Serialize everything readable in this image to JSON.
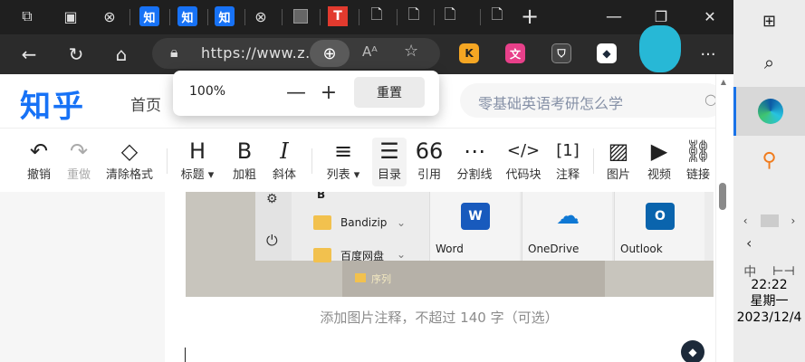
{
  "browser": {
    "tabs": [
      {
        "icon": "collections-icon"
      },
      {
        "icon": "tab-actions-icon"
      },
      {
        "icon": "blocked-page-icon"
      },
      {
        "icon": "zhihu-icon",
        "text": "知"
      },
      {
        "icon": "zhihu-icon",
        "text": "知"
      },
      {
        "icon": "zhihu-icon",
        "text": "知"
      },
      {
        "icon": "blocked-page-icon"
      },
      {
        "icon": "image-thumbnail-icon"
      },
      {
        "icon": "toutiao-icon",
        "text": "T"
      },
      {
        "icon": "page-icon"
      },
      {
        "icon": "page-icon"
      },
      {
        "icon": "page-icon"
      }
    ],
    "url": "https://www.z...",
    "window_controls": {
      "minimize": "—",
      "restore": "❐",
      "close": "✕"
    }
  },
  "zoom_popup": {
    "value": "100%",
    "minus": "—",
    "plus": "+",
    "reset_label": "重置"
  },
  "zhihu": {
    "logo": "知乎",
    "home": "首页",
    "search_placeholder": "零基础英语考研怎么学"
  },
  "toolbar": {
    "undo": "撤销",
    "redo": "重做",
    "clear_format": "清除格式",
    "heading": "标题",
    "bold": "加粗",
    "italic": "斜体",
    "list": "列表",
    "toc": "目录",
    "quote": "引用",
    "divider": "分割线",
    "code": "代码块",
    "footnote": "注释",
    "image": "图片",
    "video": "视频",
    "link": "链接",
    "icons": {
      "heading": "H",
      "bold": "B",
      "italic": "I",
      "quote": "66",
      "code": "</>",
      "footnote": "[1]"
    }
  },
  "embedded_screenshot": {
    "top_letter": "B",
    "folder1": "Bandizip",
    "folder2": "百度网盘",
    "folder3": "序列",
    "apps": [
      {
        "name": "Word",
        "letter": "W",
        "color": "#185abd"
      },
      {
        "name": "OneDrive",
        "letter": "☁",
        "color": "#0f78d4"
      },
      {
        "name": "Outlook",
        "letter": "O",
        "color": "#0a64ad"
      }
    ]
  },
  "caption_placeholder": "添加图片注释，不超过 140 字（可选）",
  "taskbar": {
    "time": "22:22",
    "weekday": "星期一",
    "date": "2023/12/4"
  }
}
